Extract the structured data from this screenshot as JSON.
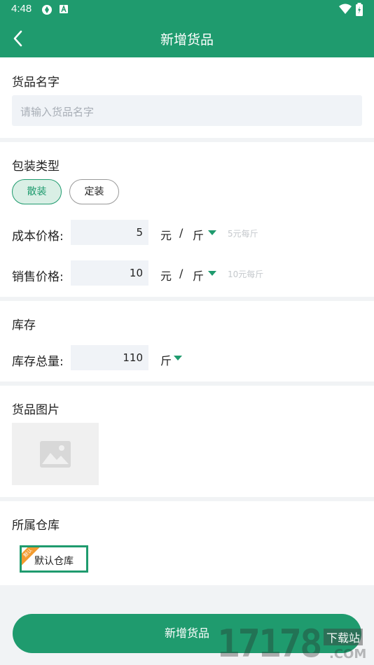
{
  "status_bar": {
    "time": "4:48"
  },
  "header": {
    "title": "新增货品"
  },
  "name_section": {
    "title": "货品名字",
    "placeholder": "请输入货品名字"
  },
  "package_section": {
    "title": "包装类型",
    "options": [
      {
        "label": "散装",
        "selected": true
      },
      {
        "label": "定装",
        "selected": false
      }
    ],
    "cost": {
      "label": "成本价格:",
      "value": "5",
      "currency": "元",
      "slash": "/",
      "unit": "斤",
      "hint": "5元每斤"
    },
    "sale": {
      "label": "销售价格:",
      "value": "10",
      "currency": "元",
      "slash": "/",
      "unit": "斤",
      "hint": "10元每斤"
    }
  },
  "stock_section": {
    "title": "库存",
    "total_label": "库存总量:",
    "total_value": "110",
    "unit": "斤"
  },
  "image_section": {
    "title": "货品图片"
  },
  "warehouse_section": {
    "title": "所属仓库",
    "ribbon": "默认",
    "warehouse_name": "默认仓库"
  },
  "submit_label": "新增货品",
  "watermark": {
    "digits": "17178",
    "site": "下载站",
    "suffix": ".COM"
  },
  "colors": {
    "primary": "#1f9b6e",
    "background": "#f1f3f5",
    "input": "#f0f3f7",
    "ribbon": "#f39b2f"
  }
}
